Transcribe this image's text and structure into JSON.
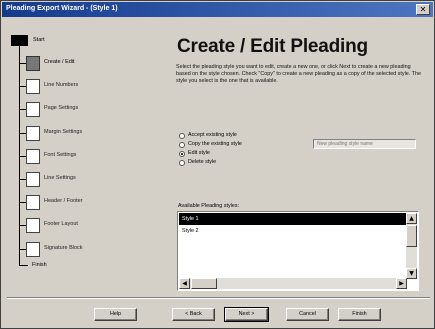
{
  "window": {
    "title": "Pleading Export Wizard - (Style 1)",
    "close_glyph": "✕"
  },
  "steps": {
    "start_label": "Start",
    "end_label": "Finish",
    "items": [
      {
        "label": "Create / Edit",
        "current": true
      },
      {
        "label": "Line Numbers",
        "current": false
      },
      {
        "label": "Page Settings",
        "current": false
      },
      {
        "label": "Margin Settings",
        "current": false
      },
      {
        "label": "Font Settings",
        "current": false
      },
      {
        "label": "Line Settings",
        "current": false
      },
      {
        "label": "Header / Footer",
        "current": false
      },
      {
        "label": "Footer Layout",
        "current": false
      },
      {
        "label": "Signature Block",
        "current": false
      }
    ]
  },
  "page": {
    "heading": "Create / Edit Pleading",
    "description": "Select the pleading style you want to edit, create a new one, or click Next to create a new pleading based on the style chosen. Check \"Copy\" to create a new pleading as a copy of the selected style. The style you select is the one that is available.",
    "options": [
      {
        "label": "Accept existing style",
        "selected": false
      },
      {
        "label": "Copy the existing style",
        "selected": false
      },
      {
        "label": "Edit style",
        "selected": true
      },
      {
        "label": "Delete style",
        "selected": false
      }
    ],
    "name_field_value": "New pleading style name",
    "list_label": "Available Pleading styles:",
    "list_items": [
      {
        "label": "Style 1",
        "selected": true
      },
      {
        "label": "Style 2",
        "selected": false
      }
    ]
  },
  "scroll": {
    "up_glyph": "▲",
    "down_glyph": "▼",
    "left_glyph": "◀",
    "right_glyph": "▶"
  },
  "buttons": {
    "help": "Help",
    "back": "< Back",
    "next": "Next >",
    "cancel": "Cancel",
    "finish": "Finish"
  }
}
